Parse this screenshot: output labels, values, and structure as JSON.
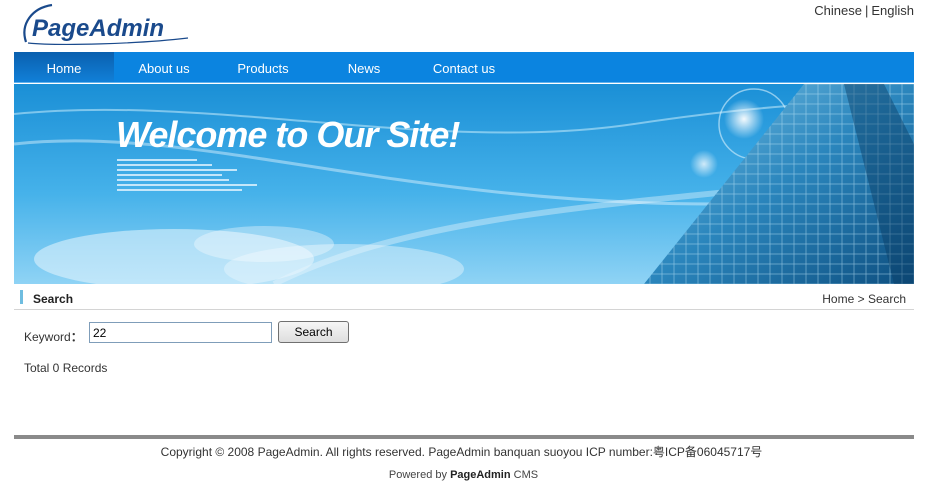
{
  "header": {
    "logo_text": "PageAdmin",
    "lang_chinese": "Chinese",
    "lang_separator": "|",
    "lang_english": "English"
  },
  "nav": {
    "items": [
      {
        "label": "Home",
        "active": true
      },
      {
        "label": "About us",
        "active": false
      },
      {
        "label": "Products",
        "active": false
      },
      {
        "label": "News",
        "active": false
      },
      {
        "label": "Contact us",
        "active": false
      }
    ]
  },
  "banner": {
    "headline": "Welcome to Our Site!"
  },
  "section": {
    "title": "Search",
    "breadcrumb_home": "Home",
    "breadcrumb_separator": ">",
    "breadcrumb_current": "Search"
  },
  "search": {
    "keyword_label": "Keyword",
    "keyword_colon": "：",
    "keyword_value": "22",
    "button_label": "Search",
    "results_text": "Total 0 Records"
  },
  "footer": {
    "copyright": "Copyright © 2008 PageAdmin. All rights reserved.  PageAdmin banquan suoyou ICP number:粤ICP备06045717号",
    "powered_prefix": "Powered by ",
    "powered_brand": "PageAdmin",
    "powered_suffix": " CMS"
  },
  "colors": {
    "nav_blue": "#0b84e0",
    "nav_active": "#0a5fae",
    "logo_blue": "#1a4a8c",
    "footer_rule": "#8a8a8a"
  }
}
